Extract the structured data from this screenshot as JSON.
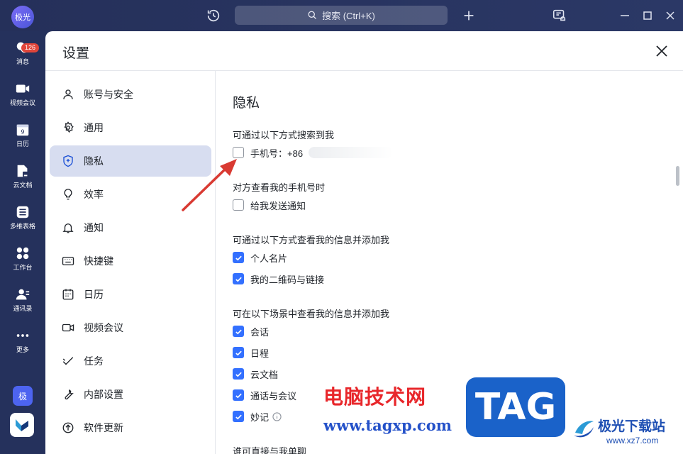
{
  "titlebar": {
    "avatar_text": "极光",
    "search_placeholder": "搜索 (Ctrl+K)"
  },
  "rail": {
    "items": [
      {
        "label": "消息",
        "icon": "chat-bubble-icon"
      },
      {
        "label": "视频会议",
        "icon": "video-camera-icon"
      },
      {
        "label": "日历",
        "icon": "calendar-icon"
      },
      {
        "label": "云文档",
        "icon": "cloud-doc-icon"
      },
      {
        "label": "多维表格",
        "icon": "table-icon"
      },
      {
        "label": "工作台",
        "icon": "grid-icon"
      },
      {
        "label": "通讯录",
        "icon": "contacts-icon"
      },
      {
        "label": "更多",
        "icon": "more-dots-icon"
      }
    ],
    "message_badge": "126",
    "brand_tile": "极"
  },
  "dialog": {
    "title": "设置",
    "nav": [
      {
        "label": "账号与安全",
        "icon": "user-icon",
        "active": false
      },
      {
        "label": "通用",
        "icon": "gear-icon",
        "active": false
      },
      {
        "label": "隐私",
        "icon": "shield-icon",
        "active": true
      },
      {
        "label": "效率",
        "icon": "bulb-icon",
        "active": false
      },
      {
        "label": "通知",
        "icon": "bell-icon",
        "active": false
      },
      {
        "label": "快捷键",
        "icon": "keyboard-icon",
        "active": false
      },
      {
        "label": "日历",
        "icon": "calendar-icon",
        "active": false
      },
      {
        "label": "视频会议",
        "icon": "video-icon",
        "active": false
      },
      {
        "label": "任务",
        "icon": "task-check-icon",
        "active": false
      },
      {
        "label": "内部设置",
        "icon": "wrench-icon",
        "active": false
      },
      {
        "label": "软件更新",
        "icon": "update-arrow-icon",
        "active": false
      }
    ]
  },
  "privacy": {
    "section_title": "隐私",
    "search_group_label": "可通过以下方式搜索到我",
    "phone_option": "手机号：+86",
    "phone_checked": false,
    "view_phone_label": "对方查看我的手机号时",
    "notify_option": "给我发送通知",
    "notify_checked": false,
    "add_via_label": "可通过以下方式查看我的信息并添加我",
    "card_option": "个人名片",
    "card_checked": true,
    "qr_option": "我的二维码与链接",
    "qr_checked": true,
    "scenes_label": "可在以下场景中查看我的信息并添加我",
    "scene_options": [
      {
        "label": "会话",
        "checked": true
      },
      {
        "label": "日程",
        "checked": true
      },
      {
        "label": "云文档",
        "checked": true
      },
      {
        "label": "通话与会议",
        "checked": true
      },
      {
        "label": "妙记",
        "checked": true
      }
    ],
    "direct_chat_label": "谁可直接与我单聊"
  },
  "watermark": {
    "brand_cn": "电脑技术网",
    "brand_url": "www.tagxp.com",
    "tag": "TAG",
    "site_name": "极光下载站",
    "site_url": "www.xz7.com"
  },
  "colors": {
    "accent": "#3370ff",
    "titlebar_bg": "#25305a",
    "nav_active_bg": "#d7ddf0",
    "badge": "#e0453a",
    "annotation_arrow": "#d93a32"
  }
}
